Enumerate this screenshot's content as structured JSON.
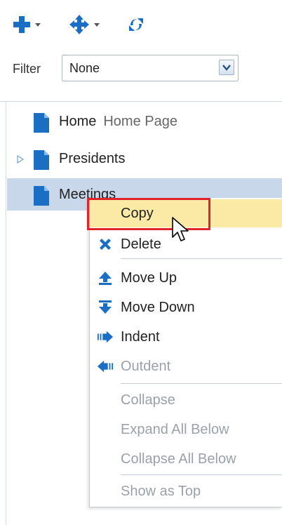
{
  "toolbar": {
    "add_icon": "plus-icon",
    "move_icon": "move-cross-icon",
    "refresh_icon": "refresh-icon",
    "accent": "#1a6fc4"
  },
  "filter": {
    "label": "Filter",
    "value": "None"
  },
  "tree": {
    "rows": [
      {
        "label": "Home",
        "description": "Home Page"
      },
      {
        "label": "Presidents",
        "description": ""
      },
      {
        "label": "Meetings",
        "description": ""
      }
    ],
    "selected_color": "#c8d7e9"
  },
  "context_menu": {
    "items": [
      {
        "label": "Copy",
        "icon": "",
        "enabled": true
      },
      {
        "label": "Delete",
        "icon": "delete-x-icon",
        "enabled": true
      },
      {
        "label": "Move Up",
        "icon": "move-up-icon",
        "enabled": true
      },
      {
        "label": "Move Down",
        "icon": "move-down-icon",
        "enabled": true
      },
      {
        "label": "Indent",
        "icon": "indent-icon",
        "enabled": true
      },
      {
        "label": "Outdent",
        "icon": "outdent-icon",
        "enabled": false
      },
      {
        "label": "Collapse",
        "icon": "",
        "enabled": false
      },
      {
        "label": "Expand All Below",
        "icon": "",
        "enabled": false
      },
      {
        "label": "Collapse All Below",
        "icon": "",
        "enabled": false
      },
      {
        "label": "Show as Top",
        "icon": "",
        "enabled": false
      }
    ],
    "hover_color": "#fbe9a6",
    "highlight_color": "#e0242a"
  }
}
